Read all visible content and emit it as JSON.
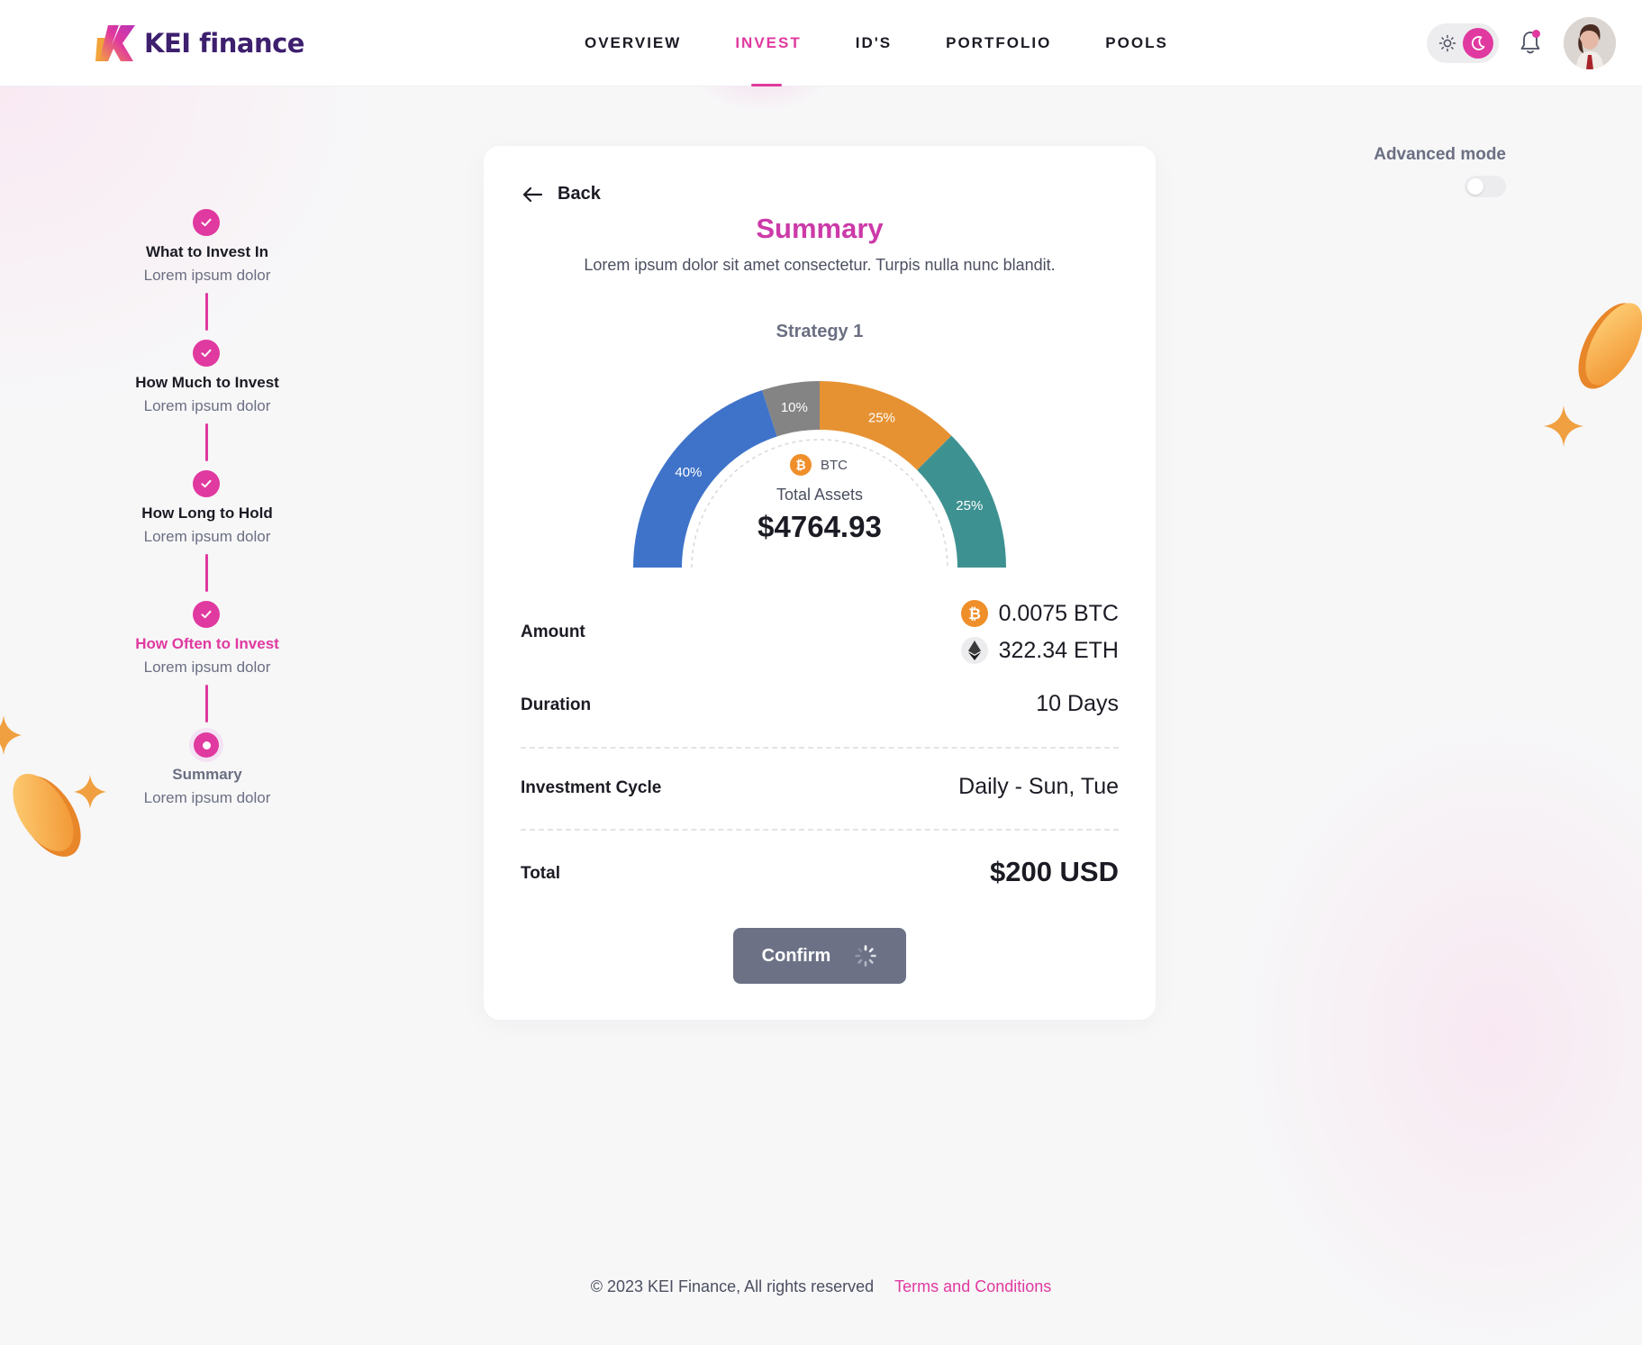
{
  "brand": {
    "name": "KEI finance"
  },
  "nav": {
    "items": [
      {
        "label": "OVERVIEW",
        "active": false
      },
      {
        "label": "INVEST",
        "active": true
      },
      {
        "label": "ID'S",
        "active": false
      },
      {
        "label": "PORTFOLIO",
        "active": false
      },
      {
        "label": "POOLS",
        "active": false
      }
    ]
  },
  "header_icons": [
    "sun-icon",
    "moon-icon",
    "bell-icon",
    "avatar"
  ],
  "advanced_mode": {
    "label": "Advanced mode",
    "enabled": false
  },
  "stepper": {
    "steps": [
      {
        "title": "What to Invest In",
        "subtitle": "Lorem ipsum dolor",
        "state": "done"
      },
      {
        "title": "How Much to Invest",
        "subtitle": "Lorem ipsum dolor",
        "state": "done"
      },
      {
        "title": "How Long to Hold",
        "subtitle": "Lorem ipsum dolor",
        "state": "done"
      },
      {
        "title": "How Often to Invest",
        "subtitle": "Lorem ipsum dolor",
        "state": "done-highlighted"
      },
      {
        "title": "Summary",
        "subtitle": "Lorem ipsum dolor",
        "state": "current"
      }
    ]
  },
  "card": {
    "back_label": "Back",
    "title": "Summary",
    "subtitle": "Lorem ipsum dolor sit amet consectetur. Turpis nulla nunc blandit.",
    "strategy_label": "Strategy 1",
    "asset_tag": "BTC",
    "total_assets_label": "Total Assets",
    "total_assets_value": "$4764.93",
    "rows": {
      "amount_label": "Amount",
      "amount_btc": "0.0075 BTC",
      "amount_eth": "322.34 ETH",
      "duration_label": "Duration",
      "duration_value": "10 Days",
      "cycle_label": "Investment Cycle",
      "cycle_value": "Daily - Sun, Tue",
      "total_label": "Total",
      "total_value": "$200 USD"
    },
    "confirm_label": "Confirm"
  },
  "chart_data": {
    "type": "pie",
    "subtype": "half-donut",
    "title": "Strategy 1",
    "slices": [
      {
        "label": "40%",
        "value": 40,
        "color": "#3f73c9"
      },
      {
        "label": "10%",
        "value": 10,
        "color": "#848484"
      },
      {
        "label": "25%",
        "value": 25,
        "color": "#e69233"
      },
      {
        "label": "25%",
        "value": 25,
        "color": "#3e9191"
      }
    ]
  },
  "footer": {
    "copyright": "© 2023 KEI Finance, All rights reserved",
    "terms_label": "Terms and Conditions"
  },
  "colors": {
    "accent": "#e0399f",
    "title": "#cc3aa8",
    "confirm_button": "#6c7186"
  }
}
